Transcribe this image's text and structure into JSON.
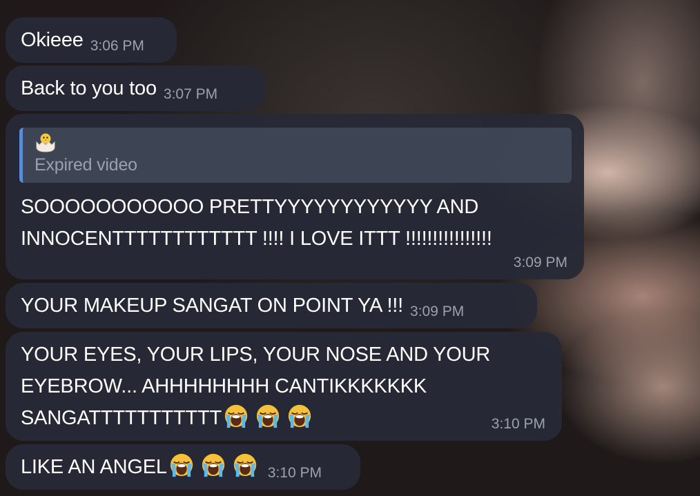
{
  "messages": [
    {
      "text": "Okieee",
      "time": "3:06 PM"
    },
    {
      "text": "Back to you too",
      "time": "3:07 PM"
    },
    {
      "reply": {
        "icon": "hatching-chick-icon",
        "label": "Expired video"
      },
      "lines": [
        "SOOOOOOOOOOO PRETTYYYYYYYYYYYY AND",
        "INNOCENTTTTTTTTTTTT !!!! I LOVE ITTT !!!!!!!!!!!!!!!!"
      ],
      "time": "3:09 PM"
    },
    {
      "text": "YOUR MAKEUP SANGAT ON POINT YA !!!",
      "time": "3:09 PM"
    },
    {
      "lines": [
        "YOUR EYES, YOUR LIPS, YOUR NOSE AND YOUR",
        "EYEBROW... AHHHHHHHH CANTIKKKKKKK",
        "SANGATTTTTTTTTTT"
      ],
      "emoji": [
        "loudly-crying-face",
        "loudly-crying-face",
        "loudly-crying-face"
      ],
      "time": "3:10 PM"
    },
    {
      "text": "LIKE AN ANGEL",
      "emoji": [
        "loudly-crying-face",
        "loudly-crying-face",
        "loudly-crying-face"
      ],
      "time": "3:10 PM"
    }
  ],
  "colors": {
    "bubble": "#262a36",
    "text": "#ffffff",
    "time": "#9ba1ad",
    "reply_bar": "#5b8dd6"
  }
}
